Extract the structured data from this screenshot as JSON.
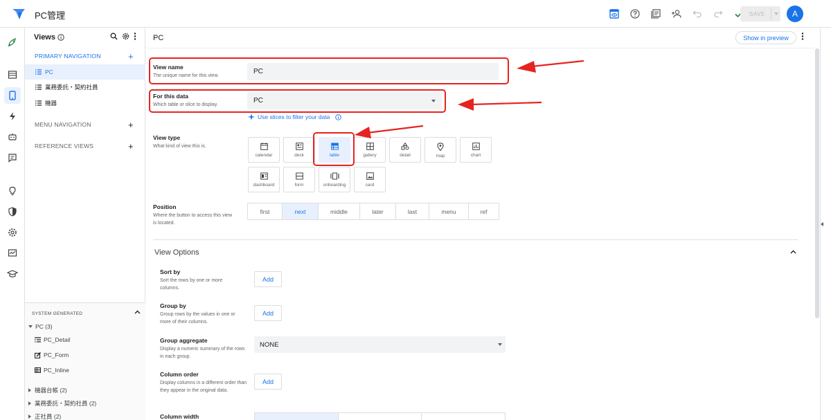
{
  "app": {
    "title": "PC管理",
    "save_label": "SAVE",
    "avatar_initial": "A",
    "accent": "#1a73e8",
    "annotation_color": "#e52421"
  },
  "views_panel": {
    "header": "Views",
    "primary_nav_label": "PRIMARY NAVIGATION",
    "primary_items": [
      {
        "label": "PC",
        "active": true
      },
      {
        "label": "業務委託・契約社員",
        "active": false
      },
      {
        "label": "機器",
        "active": false
      }
    ],
    "menu_nav_label": "MENU NAVIGATION",
    "reference_views_label": "REFERENCE VIEWS",
    "system_generated": {
      "header": "SYSTEM GENERATED",
      "group_open": "PC (3)",
      "children": [
        "PC_Detail",
        "PC_Form",
        "PC_Inline"
      ],
      "groups_closed": [
        "機器台帳 (2)",
        "業務委託・契約社員 (2)",
        "正社員 (2)"
      ]
    }
  },
  "main": {
    "title": "PC",
    "show_preview_label": "Show in preview",
    "view_name": {
      "label": "View name",
      "sub": "The unique name for this view.",
      "value": "PC"
    },
    "for_this_data": {
      "label": "For this data",
      "sub": "Which table or slice to display.",
      "value": "PC"
    },
    "slice_link": "Use slices to filter your data",
    "view_type": {
      "label": "View type",
      "sub": "What kind of view this is.",
      "options": [
        "calendar",
        "deck",
        "table",
        "gallery",
        "detail",
        "map",
        "chart",
        "dashboard",
        "form",
        "onboarding",
        "card"
      ],
      "selected": "table"
    },
    "position": {
      "label": "Position",
      "sub": "Where the button to access this view is located.",
      "options": [
        "first",
        "next",
        "middle",
        "later",
        "last",
        "menu",
        "ref"
      ],
      "selected": "next"
    },
    "view_options": {
      "title": "View Options",
      "sort_by": {
        "label": "Sort by",
        "sub": "Sort the rows by one or more columns.",
        "button": "Add"
      },
      "group_by": {
        "label": "Group by",
        "sub": "Group rows by the values in one or more of their columns.",
        "button": "Add"
      },
      "group_aggregate": {
        "label": "Group aggregate",
        "sub": "Display a numeric summary of the rows in each group.",
        "value": "NONE"
      },
      "column_order": {
        "label": "Column order",
        "sub": "Display columns in a different order than they appear in the original data.",
        "button": "Add"
      },
      "column_width": {
        "label": "Column width"
      }
    }
  }
}
